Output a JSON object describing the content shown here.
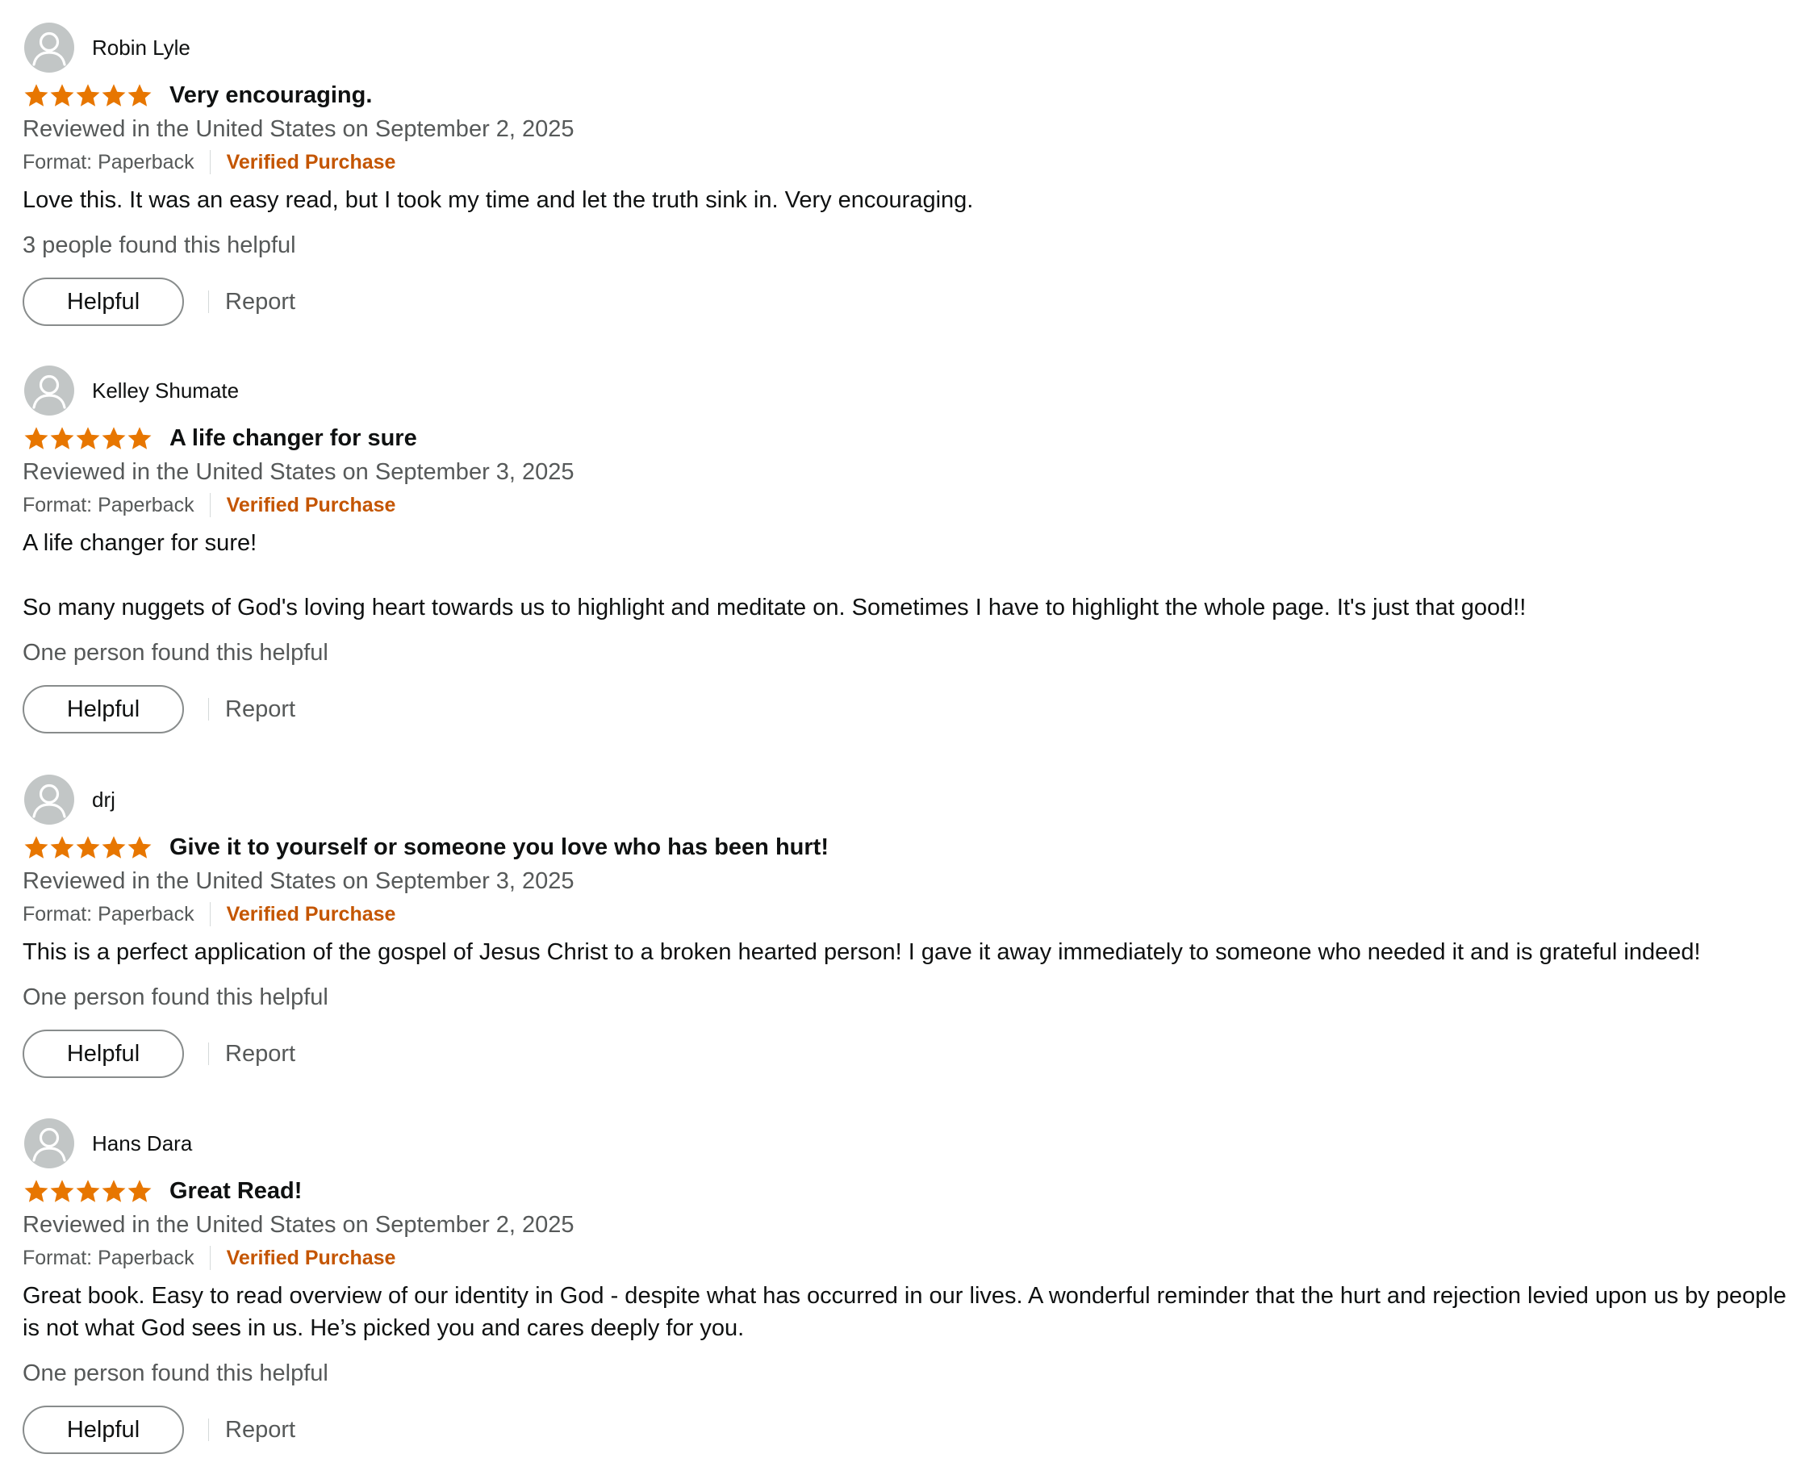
{
  "colors": {
    "star": "#e77600",
    "verified": "#c45500",
    "muted_text": "#565959",
    "avatar_bg": "#c2c6c6"
  },
  "icons": {
    "avatar": "default-user-avatar-icon",
    "star": "filled-star-icon"
  },
  "reviews": [
    {
      "reviewer": "Robin Lyle",
      "rating": 5,
      "title": "Very encouraging.",
      "date": "Reviewed in the United States on September 2, 2025",
      "format": "Format: Paperback",
      "verified": "Verified Purchase",
      "body": [
        "Love this. It was an easy read, but I took my time and let the truth sink in. Very encouraging."
      ],
      "helpful_count": "3 people found this helpful",
      "helpful_label": "Helpful",
      "report_label": "Report"
    },
    {
      "reviewer": "Kelley Shumate",
      "rating": 5,
      "title": "A life changer for sure",
      "date": "Reviewed in the United States on September 3, 2025",
      "format": "Format: Paperback",
      "verified": "Verified Purchase",
      "body": [
        "A life changer for sure!",
        "So many nuggets of God's loving heart towards us to highlight and meditate on. Sometimes I have to highlight the whole page. It's just that good!!"
      ],
      "helpful_count": "One person found this helpful",
      "helpful_label": "Helpful",
      "report_label": "Report"
    },
    {
      "reviewer": "drj",
      "rating": 5,
      "title": "Give it to yourself or someone you love who has been hurt!",
      "date": "Reviewed in the United States on September 3, 2025",
      "format": "Format: Paperback",
      "verified": "Verified Purchase",
      "body": [
        "This is a perfect application of the gospel of Jesus Christ to a broken hearted person! I gave it away immediately to someone who needed it and is grateful indeed!"
      ],
      "helpful_count": "One person found this helpful",
      "helpful_label": "Helpful",
      "report_label": "Report"
    },
    {
      "reviewer": "Hans Dara",
      "rating": 5,
      "title": "Great Read!",
      "date": "Reviewed in the United States on September 2, 2025",
      "format": "Format: Paperback",
      "verified": "Verified Purchase",
      "body": [
        "Great book. Easy to read overview of our identity in God - despite what has occurred in our lives. A wonderful reminder that the hurt and rejection levied upon us by people is not what God sees in us. He’s picked you and cares deeply for you."
      ],
      "helpful_count": "One person found this helpful",
      "helpful_label": "Helpful",
      "report_label": "Report"
    }
  ]
}
